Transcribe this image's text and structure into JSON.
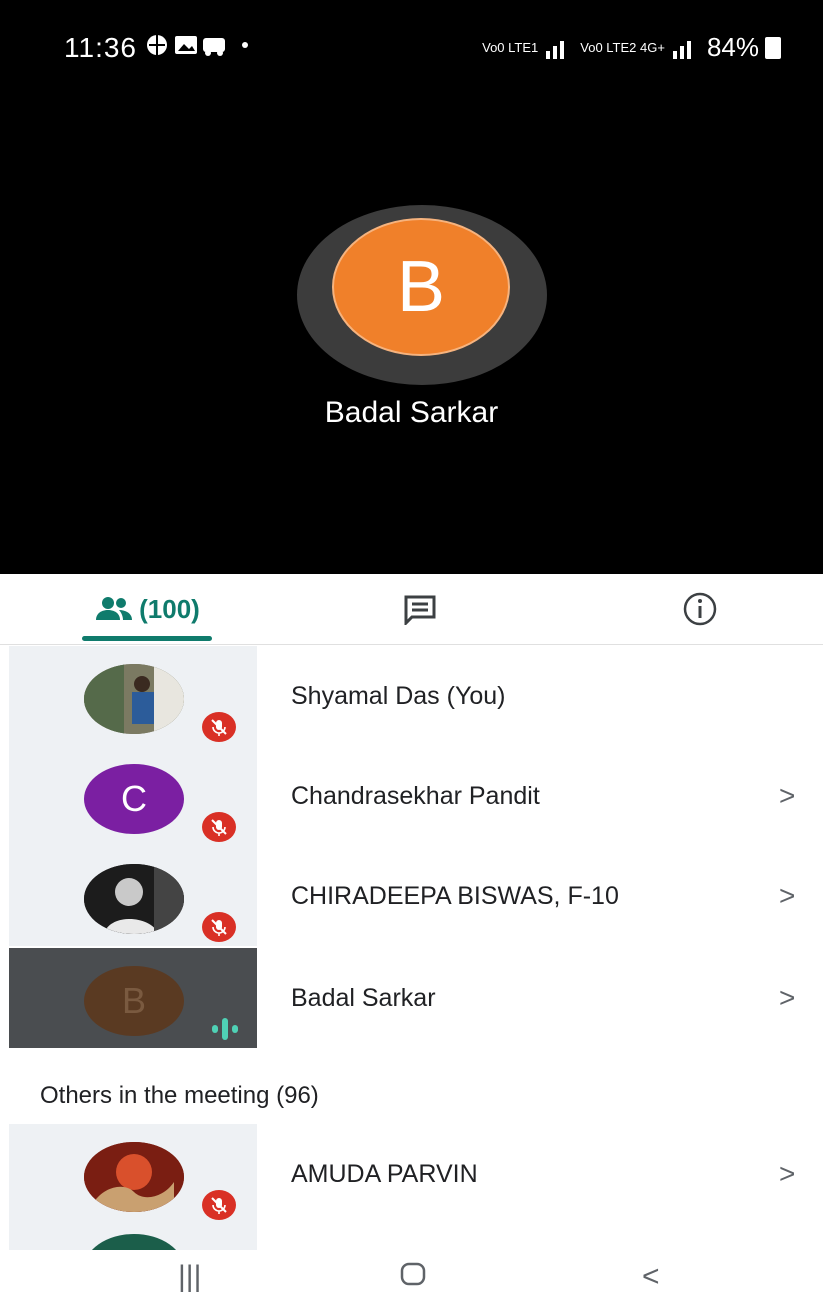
{
  "status_bar": {
    "time": "11:36",
    "left_icons": [
      "globe-icon",
      "image-icon",
      "car-icon",
      "dot"
    ],
    "network_left": "Vo0 LTE1",
    "network_right": "Vo0 LTE2 4G+",
    "battery": "84%"
  },
  "active_speaker": {
    "initial": "B",
    "name": "Badal Sarkar",
    "avatar_color": "#f0802a"
  },
  "tabs": {
    "people_count": "(100)",
    "people_icon": "people-icon",
    "chat_icon": "chat-icon",
    "info_icon": "info-icon",
    "accent": "#0f7b6c"
  },
  "participants": [
    {
      "name": "Shyamal Das (You)",
      "avatar": "photo",
      "status": "muted",
      "chevron": ""
    },
    {
      "name": "Chandrasekhar Pandit",
      "avatar": "C",
      "avatar_color": "#7b1fa2",
      "status": "muted",
      "chevron": ">"
    },
    {
      "name": "CHIRADEEPA BISWAS, F-10",
      "avatar": "photo",
      "status": "muted",
      "chevron": ">"
    },
    {
      "name": "Badal Sarkar",
      "avatar": "B",
      "avatar_color": "#5a3a22",
      "status": "speaking",
      "chevron": ">"
    }
  ],
  "others_label": "Others in the meeting (96)",
  "others": [
    {
      "name": "AMUDA PARVIN",
      "avatar": "photo",
      "status": "muted",
      "chevron": ">"
    }
  ],
  "nav": {
    "recents": "|||",
    "home": "○",
    "back": "<"
  }
}
